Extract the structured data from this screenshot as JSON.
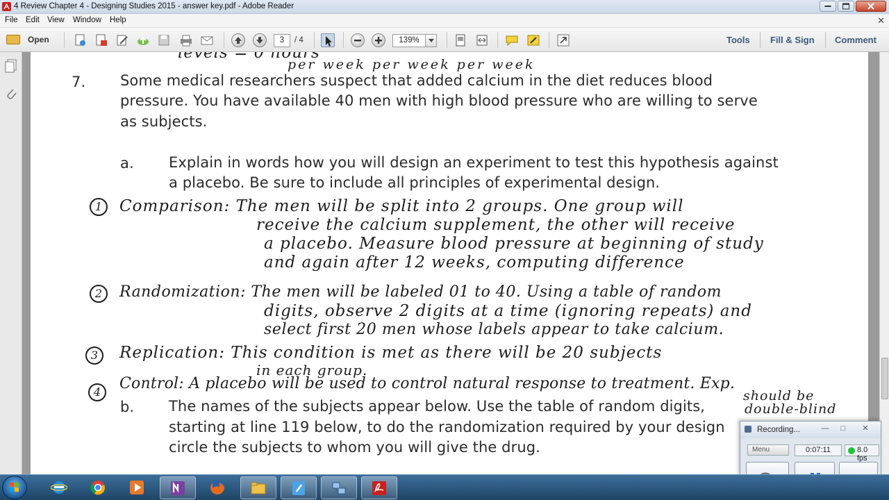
{
  "window": {
    "title": "4 Review Chapter 4 - Designing Studies 2015 - answer key.pdf - Adobe Reader"
  },
  "menu": {
    "items": [
      "File",
      "Edit",
      "View",
      "Window",
      "Help"
    ]
  },
  "toolbar": {
    "open_label": "Open",
    "current_page": "3",
    "page_total": "/ 4",
    "zoom": "139%",
    "tools_label": "Tools",
    "fill_sign_label": "Fill & Sign",
    "comment_label": "Comment"
  },
  "document": {
    "top_handwriting_1": "levels = 0 hours",
    "top_handwriting_2": "per week   per week   per week",
    "q7_number": "7.",
    "q7_line1": "Some medical researchers suspect that added calcium in the diet reduces blood",
    "q7_line2": "pressure.  You have available 40 men with high blood pressure who are willing to serve",
    "q7_line3": "as subjects.",
    "a_label": "a.",
    "a_line1": "Explain in words how you will design an experiment to test this hypothesis against",
    "a_line2": "a placebo. Be sure to include all principles of experimental design.",
    "answers": [
      {
        "num": "1",
        "lines": [
          "Comparison: The men will be split into 2 groups. One group will",
          "receive the calcium supplement, the other will receive",
          "a placebo. Measure blood pressure at beginning of study",
          "and again after 12 weeks, computing difference"
        ]
      },
      {
        "num": "2",
        "lines": [
          "Randomization: The men will be labeled 01 to 40. Using a table of random",
          "digits, observe 2 digits at a time (ignoring repeats) and",
          "select first 20 men whose labels appear to take calcium."
        ]
      },
      {
        "num": "3",
        "lines": [
          "Replication: This condition is met as there will be 20 subjects",
          "in each group."
        ]
      },
      {
        "num": "4",
        "lines": [
          "Control: A placebo will be used to control natural response to treatment. Exp.",
          "should be",
          "double-blind"
        ]
      }
    ],
    "b_label": "b.",
    "b_line1": "The names of the subjects appear below.  Use the table of random digits,",
    "b_line2": "starting at line 119 below, to do the randomization required by your design",
    "b_line3": "circle the subjects to whom you will give the drug."
  },
  "recorder": {
    "title": "Recording...",
    "menu_label": "Menu",
    "elapsed": "0:07:11",
    "fps": "8.0 fps"
  },
  "taskbar": {
    "apps": [
      "windows-explorer",
      "internet-explorer",
      "chrome",
      "media-player",
      "onenote",
      "firefox",
      "file-explorer",
      "notepad",
      "network-app",
      "adobe-reader"
    ]
  },
  "colors": {
    "adobe_red": "#c9211e",
    "link_blue": "#3a5a7a",
    "taskbar": "#1f4466"
  }
}
